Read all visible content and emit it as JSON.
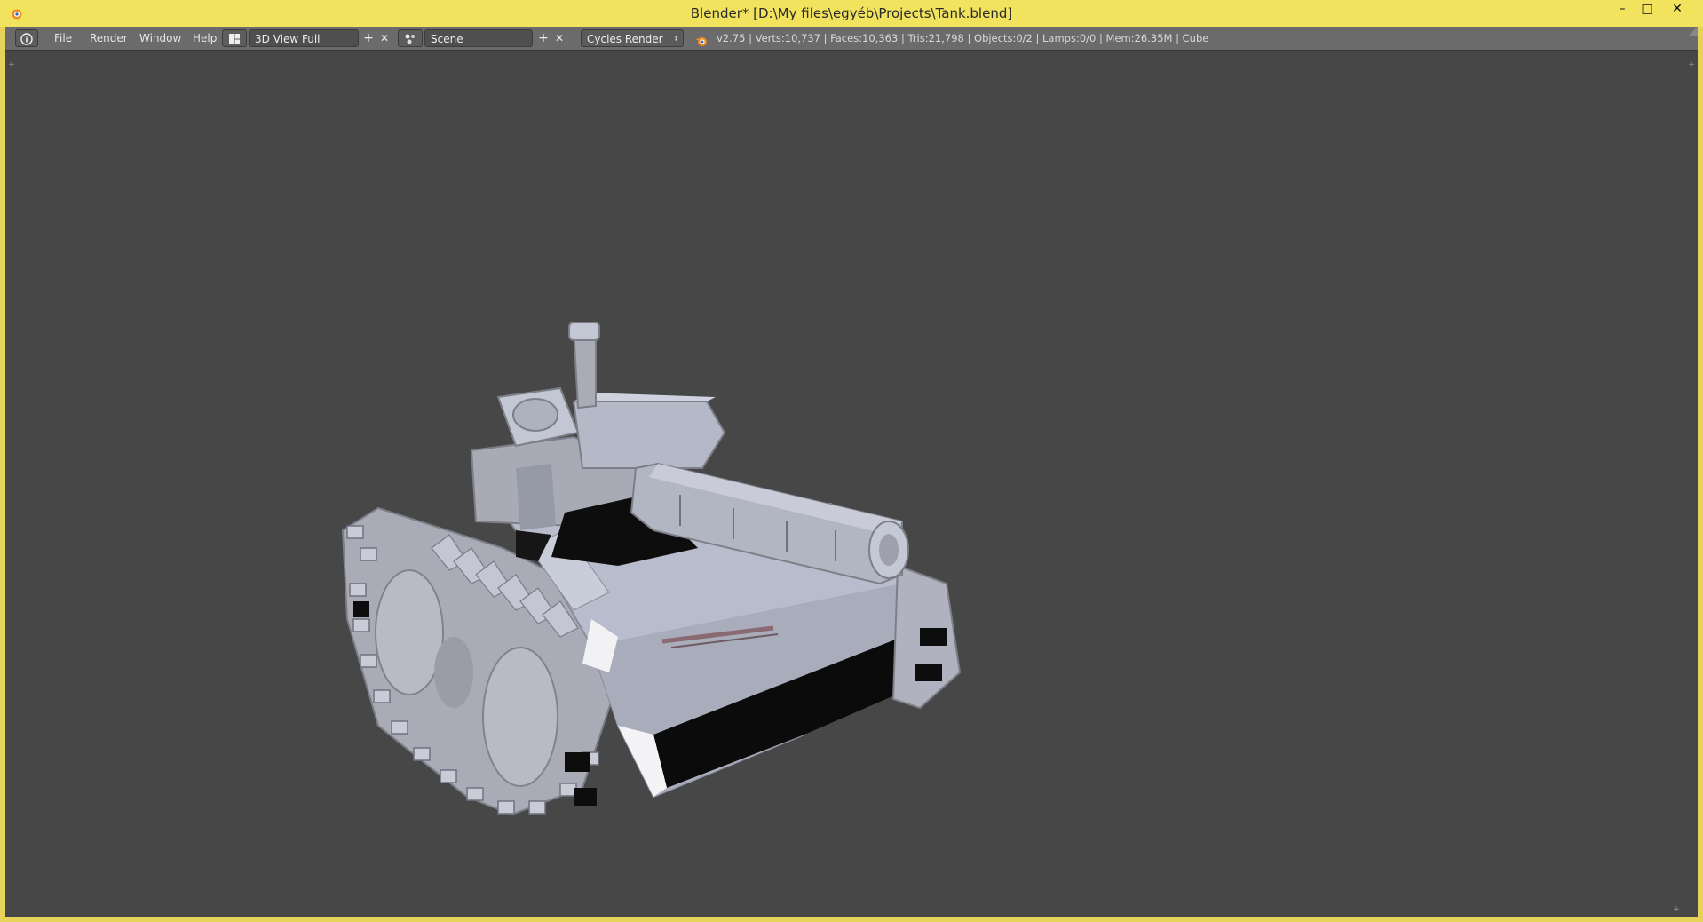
{
  "window": {
    "title": "Blender* [D:\\My files\\egyéb\\Projects\\Tank.blend]",
    "controls": {
      "minimize": "–",
      "maximize": "□",
      "close": "✕"
    }
  },
  "header": {
    "menus": [
      "File",
      "Render",
      "Window",
      "Help"
    ],
    "screen_layout": "3D View Full",
    "scene": "Scene",
    "render_engine": "Cycles Render",
    "add_symbol": "+",
    "close_symbol": "✕",
    "stats": "v2.75 | Verts:10,737 | Faces:10,363 | Tris:21,798 | Objects:0/2 | Lamps:0/0 | Mem:26.35M | Cube"
  },
  "viewport": {
    "object": "Cube",
    "background": "#474747"
  },
  "colors": {
    "titlebar": "#f2e35f",
    "header": "#6b6b6b",
    "tank_light": "#b9bccc",
    "tank_mid": "#9ea0ad",
    "tank_dark": "#0c0c0c"
  },
  "icons": [
    "blender-logo-icon",
    "info-editor-icon",
    "screen-layout-icon",
    "scene-icon",
    "blender-render-icon"
  ]
}
